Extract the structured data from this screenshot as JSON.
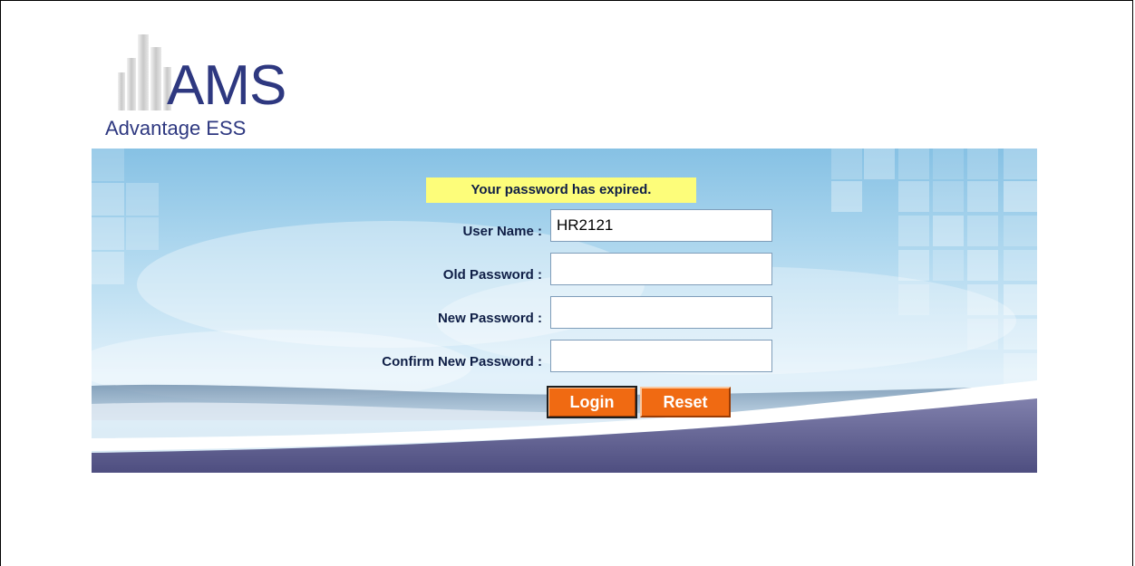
{
  "logo": {
    "brand": "AMS",
    "subtitle": "Advantage ESS",
    "icon": "buildings-icon"
  },
  "form": {
    "message": "Your password has expired.",
    "username_label": "User Name :",
    "username_value": "HR2121",
    "old_password_label": "Old Password :",
    "new_password_label": "New Password :",
    "confirm_password_label": "Confirm New Password :",
    "login_label": "Login",
    "reset_label": "Reset"
  },
  "colors": {
    "brand_text": "#2e3880",
    "message_bg": "#fdfd7a",
    "button_bg": "#f06a12",
    "banner_sky": "#a9d4ee",
    "banner_purple": "#5a5a8c"
  }
}
